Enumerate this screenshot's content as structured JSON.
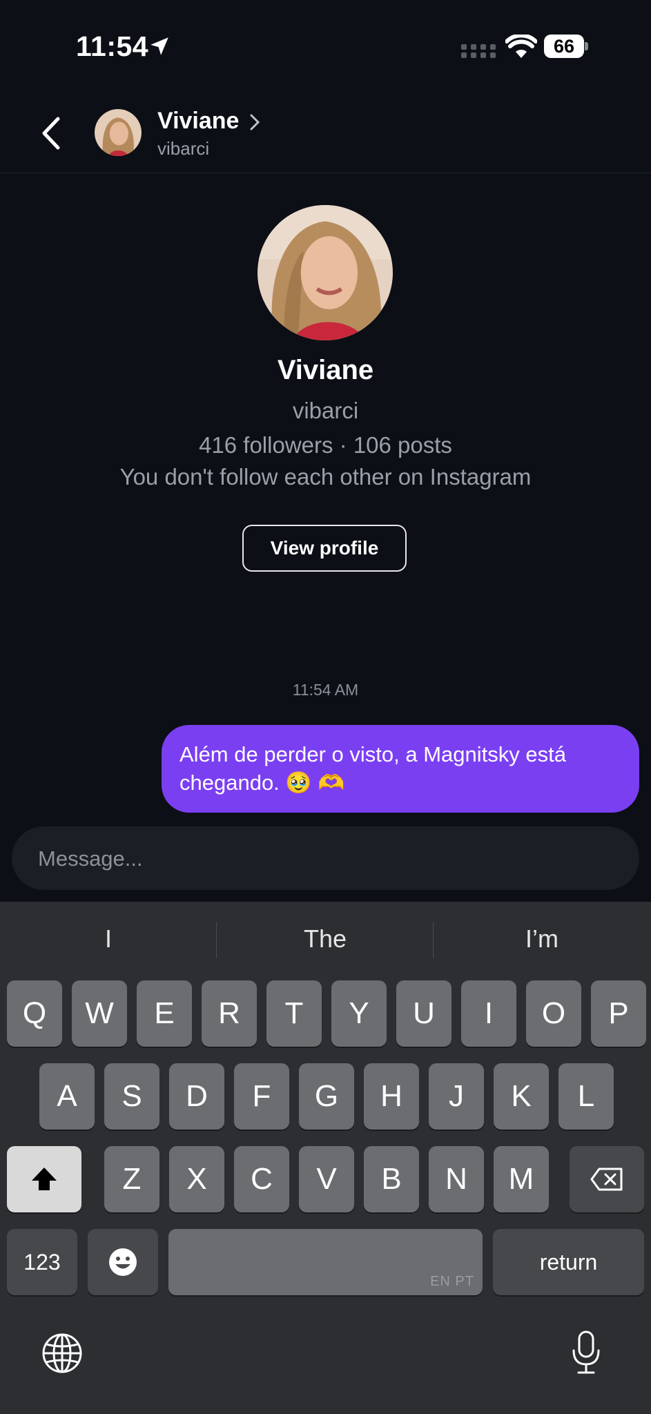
{
  "status_bar": {
    "time": "11:54",
    "battery": "66"
  },
  "header": {
    "name": "Viviane",
    "username": "vibarci"
  },
  "profile": {
    "name": "Viviane",
    "username": "vibarci",
    "stats": "416 followers · 106 posts",
    "relation": "You don't follow each other on Instagram",
    "view_profile_label": "View profile"
  },
  "messages": {
    "timestamp": "11:54 AM",
    "items": [
      {
        "direction": "outgoing",
        "text": "Além de perder o visto, a Magnitsky está chegando. 🥹 🫶"
      }
    ]
  },
  "composer": {
    "placeholder": "Message..."
  },
  "keyboard": {
    "suggestions": [
      "I",
      "The",
      "I’m"
    ],
    "row1": [
      "Q",
      "W",
      "E",
      "R",
      "T",
      "Y",
      "U",
      "I",
      "O",
      "P"
    ],
    "row2": [
      "A",
      "S",
      "D",
      "F",
      "G",
      "H",
      "J",
      "K",
      "L"
    ],
    "row3": [
      "Z",
      "X",
      "C",
      "V",
      "B",
      "N",
      "M"
    ],
    "numbers_label": "123",
    "space_languages": "EN PT",
    "return_label": "return"
  },
  "colors": {
    "accent_bubble": "#7b3ff2",
    "background": "#0c0f16",
    "keyboard": "#2c2e32"
  },
  "icons": [
    "location-arrow-icon",
    "signal-icon",
    "wifi-icon",
    "battery-icon",
    "back-chevron-icon",
    "chevron-right-icon",
    "shift-icon",
    "delete-icon",
    "emoji-icon",
    "globe-icon",
    "microphone-icon"
  ]
}
